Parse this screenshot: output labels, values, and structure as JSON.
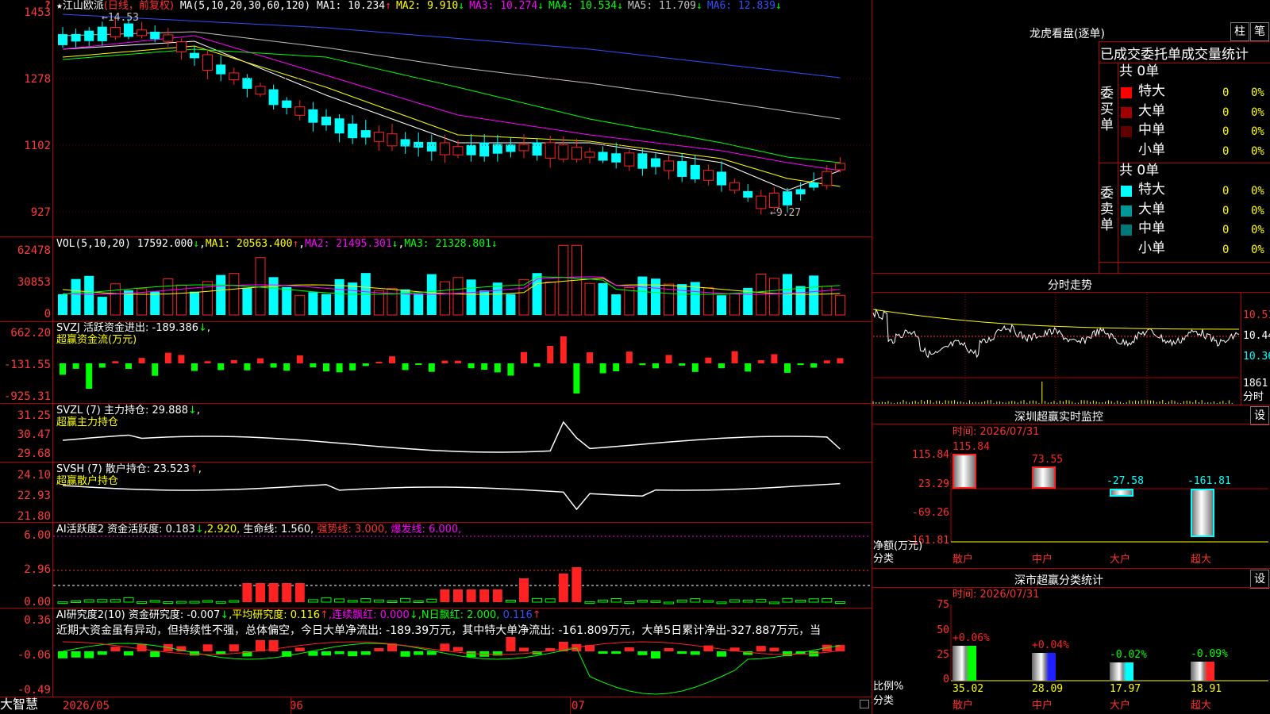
{
  "header": {
    "marker": "?",
    "star": "★",
    "stock_name": "江山欧派",
    "period": "(日线，前复权)",
    "ma_params": "MA(5,10,20,30,60,120)",
    "ma_items": [
      {
        "label": "MA1:",
        "value": "10.234",
        "arrow": "↑",
        "color": "#ffffff"
      },
      {
        "label": "MA2:",
        "value": "9.910",
        "arrow": "↓",
        "color": "#ffff00"
      },
      {
        "label": "MA3:",
        "value": "10.274",
        "arrow": "↓",
        "color": "#ff00ff"
      },
      {
        "label": "MA4:",
        "value": "10.534",
        "arrow": "↓",
        "color": "#00ff00"
      },
      {
        "label": "MA5:",
        "value": "11.709",
        "arrow": "↓",
        "color": "#c0c0c0"
      },
      {
        "label": "MA6:",
        "value": "12.839",
        "arrow": "↓",
        "color": "#3050ff"
      }
    ],
    "high_marker": "14.53",
    "low_marker": "9.27"
  },
  "axes": {
    "price": [
      "1453",
      "1278",
      "1102",
      "927"
    ],
    "vol": [
      "62478",
      "30853",
      "0"
    ],
    "svzj": [
      "662.20",
      "-131.55",
      "-925.31"
    ],
    "svzl": [
      "31.25",
      "30.47",
      "29.68"
    ],
    "svsh": [
      "24.10",
      "22.93",
      "21.80"
    ],
    "ai2": [
      "6.00",
      "2.96",
      "0.00"
    ],
    "ai3": [
      "0.36",
      "-0.06",
      "-0.49"
    ]
  },
  "vol_header": {
    "name": "VOL(5,10,20)",
    "value": "17592.000",
    "arrow": "↓",
    "ma1": "MA1: 20563.400",
    "ma1_arrow": "↑",
    "ma2": "MA2: 21495.301",
    "ma2_arrow": "↓",
    "ma3": "MA3: 21328.801",
    "ma3_arrow": "↓"
  },
  "svzj_header": {
    "name": "SVZJ",
    "desc": "活跃资金进出: -189.386",
    "arrow": "↓",
    "comma": ",",
    "sub": "超赢资金流(万元)"
  },
  "svzl_header": {
    "name": "SVZL (7)",
    "desc": "主力持仓: 29.888",
    "arrow": "↓",
    "comma": ",",
    "sub": "超赢主力持仓"
  },
  "svsh_header": {
    "name": "SVSH (7)",
    "desc": "散户持仓: 23.523",
    "arrow": "↑",
    "comma": ",",
    "sub": "超赢散户持仓"
  },
  "ai2_header": {
    "name": "AI活跃度2",
    "desc": "资金活跃度: 0.183",
    "arrow": "↓",
    "v2": ",2.920,",
    "life": "生命线: 1.560,",
    "strong": "强势线: 3.000,",
    "burst": "爆发线: 6.000,"
  },
  "ai3_header": {
    "name": "AI研究度2(10)",
    "desc": "资金研究度: -0.007",
    "arrow": "↓",
    "avg": ",平均研究度: 0.116",
    "avg_arrow": "↑",
    "cont": ",连续飘红: 0.000",
    "cont_arrow": "↓",
    "nday": ",N日飘红: 2.000,",
    "last": "0.116",
    "last_arrow": "↑",
    "comment": "近期大资金虽有异动，但持续性不强，总体偏空，今日大单净流出: -189.39万元，其中特大单净流出: -161.809万元，大单5日累计净出-327.887万元，当"
  },
  "xaxis": {
    "brand": "大智慧",
    "labels": [
      "2026/05",
      "06",
      "07"
    ]
  },
  "right": {
    "lh_title": "龙虎看盘(逐单)",
    "btn_bar": "柱",
    "btn_pen": "笔",
    "stats_title": "已成交委托单成交量统计",
    "buy_label": "委买单",
    "sell_label": "委卖单",
    "buy_total": "共 0单",
    "sell_total": "共 0单",
    "buy_rows": [
      {
        "name": "特大",
        "count": "0",
        "pct": "0%",
        "color": "#ff0000"
      },
      {
        "name": "大单",
        "count": "0",
        "pct": "0%",
        "color": "#a00000"
      },
      {
        "name": "中单",
        "count": "0",
        "pct": "0%",
        "color": "#600000"
      },
      {
        "name": "小单",
        "count": "0",
        "pct": "0%",
        "color": ""
      }
    ],
    "sell_rows": [
      {
        "name": "特大",
        "count": "0",
        "pct": "0%",
        "color": "#00ffff"
      },
      {
        "name": "大单",
        "count": "0",
        "pct": "0%",
        "color": "#009999"
      },
      {
        "name": "中单",
        "count": "0",
        "pct": "0%",
        "color": "#007777"
      },
      {
        "name": "小单",
        "count": "0",
        "pct": "0%",
        "color": ""
      }
    ],
    "fs_title": "分时走势",
    "fs_prices": [
      "10.51",
      "10.44",
      "10.36"
    ],
    "fs_vol": "1861",
    "fs_unit": "分时",
    "monitor_title": "深圳超赢实时监控",
    "monitor_btn": "设",
    "monitor_time": "时间: 2026/07/31",
    "monitor_axis": [
      "115.84",
      "23.29",
      "-69.26",
      "-161.81"
    ],
    "monitor_ylabel": "净额(万元)",
    "monitor_xlabel": "分类",
    "monitor_bars": [
      {
        "name": "散户",
        "value": 115.84,
        "label": "115.84",
        "color": "#ff2222"
      },
      {
        "name": "中户",
        "value": 73.55,
        "label": "73.55",
        "color": "#ff2222"
      },
      {
        "name": "大户",
        "value": -27.58,
        "label": "-27.58",
        "color": "#00ffff"
      },
      {
        "name": "超大",
        "value": -161.81,
        "label": "-161.81",
        "color": "#00ffff"
      }
    ],
    "cat_title": "深市超赢分类统计",
    "cat_btn": "设",
    "cat_time": "时间: 2026/07/31",
    "cat_axis": [
      "75",
      "50",
      "25",
      "0"
    ],
    "cat_ylabel": "比例%",
    "cat_xlabel": "分类",
    "cat_bars": [
      {
        "name": "散户",
        "value": 35.02,
        "label": "35.02",
        "change": "+0.06%",
        "fill": "#00ff00",
        "change_color": "#ff2222"
      },
      {
        "name": "中户",
        "value": 28.09,
        "label": "28.09",
        "change": "+0.04%",
        "fill": "#2020ff",
        "change_color": "#ff2222"
      },
      {
        "name": "大户",
        "value": 17.97,
        "label": "17.97",
        "change": "-0.02%",
        "fill": "#00ffff",
        "change_color": "#00ff00"
      },
      {
        "name": "超大",
        "value": 18.91,
        "label": "18.91",
        "change": "-0.09%",
        "fill": "#ff2222",
        "change_color": "#00ff00"
      }
    ]
  },
  "colors": {
    "up": "#ff2222",
    "down": "#00ffff",
    "grid": "#b00000",
    "axis_text": "#ff3b3b"
  }
}
